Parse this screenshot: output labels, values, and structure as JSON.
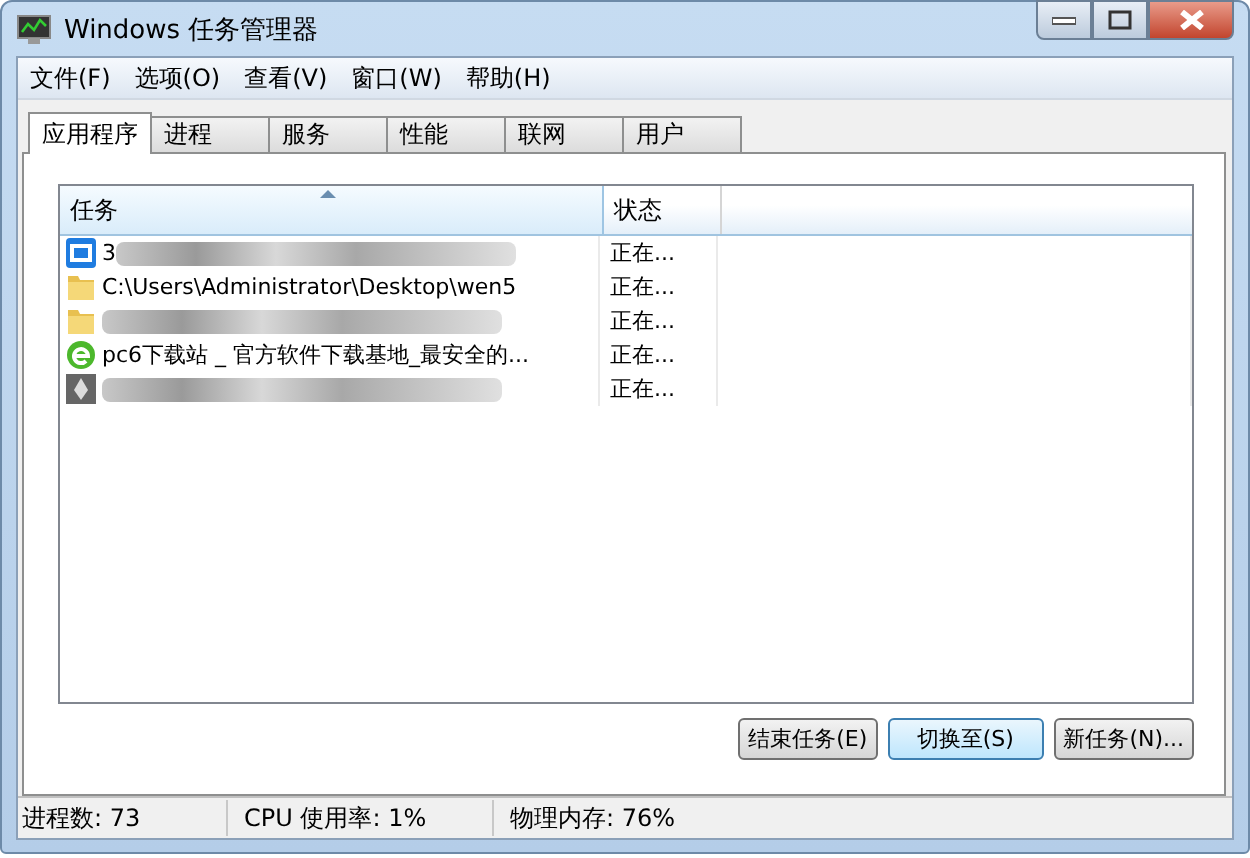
{
  "window": {
    "title": "Windows 任务管理器"
  },
  "menu": [
    "文件(F)",
    "选项(O)",
    "查看(V)",
    "窗口(W)",
    "帮助(H)"
  ],
  "tabs": [
    {
      "label": "应用程序",
      "selected": true
    },
    {
      "label": "进程",
      "selected": false
    },
    {
      "label": "服务",
      "selected": false
    },
    {
      "label": "性能",
      "selected": false
    },
    {
      "label": "联网",
      "selected": false
    },
    {
      "label": "用户",
      "selected": false
    }
  ],
  "table": {
    "columns": [
      "任务",
      "状态"
    ],
    "rows": [
      {
        "kind": "app",
        "name": "3",
        "blurred": true,
        "status": "正在..."
      },
      {
        "kind": "folder",
        "name": "C:\\Users\\Administrator\\Desktop\\wen5",
        "blurred": false,
        "status": "正在..."
      },
      {
        "kind": "folder",
        "blurred": true,
        "status": "正在..."
      },
      {
        "kind": "browser",
        "name": "pc6下载站 _ 官方软件下载基地_最安全的...",
        "blurred": false,
        "status": "正在..."
      },
      {
        "kind": "pen",
        "blurred": true,
        "status": "正在..."
      }
    ]
  },
  "buttons": [
    {
      "label": "结束任务(E)",
      "selected": false
    },
    {
      "label": "切换至(S)",
      "selected": true
    },
    {
      "label": "新任务(N)...",
      "selected": false
    }
  ],
  "status_bar": [
    "进程数: 73",
    "CPU 使用率: 1%",
    "物理内存: 76%"
  ]
}
